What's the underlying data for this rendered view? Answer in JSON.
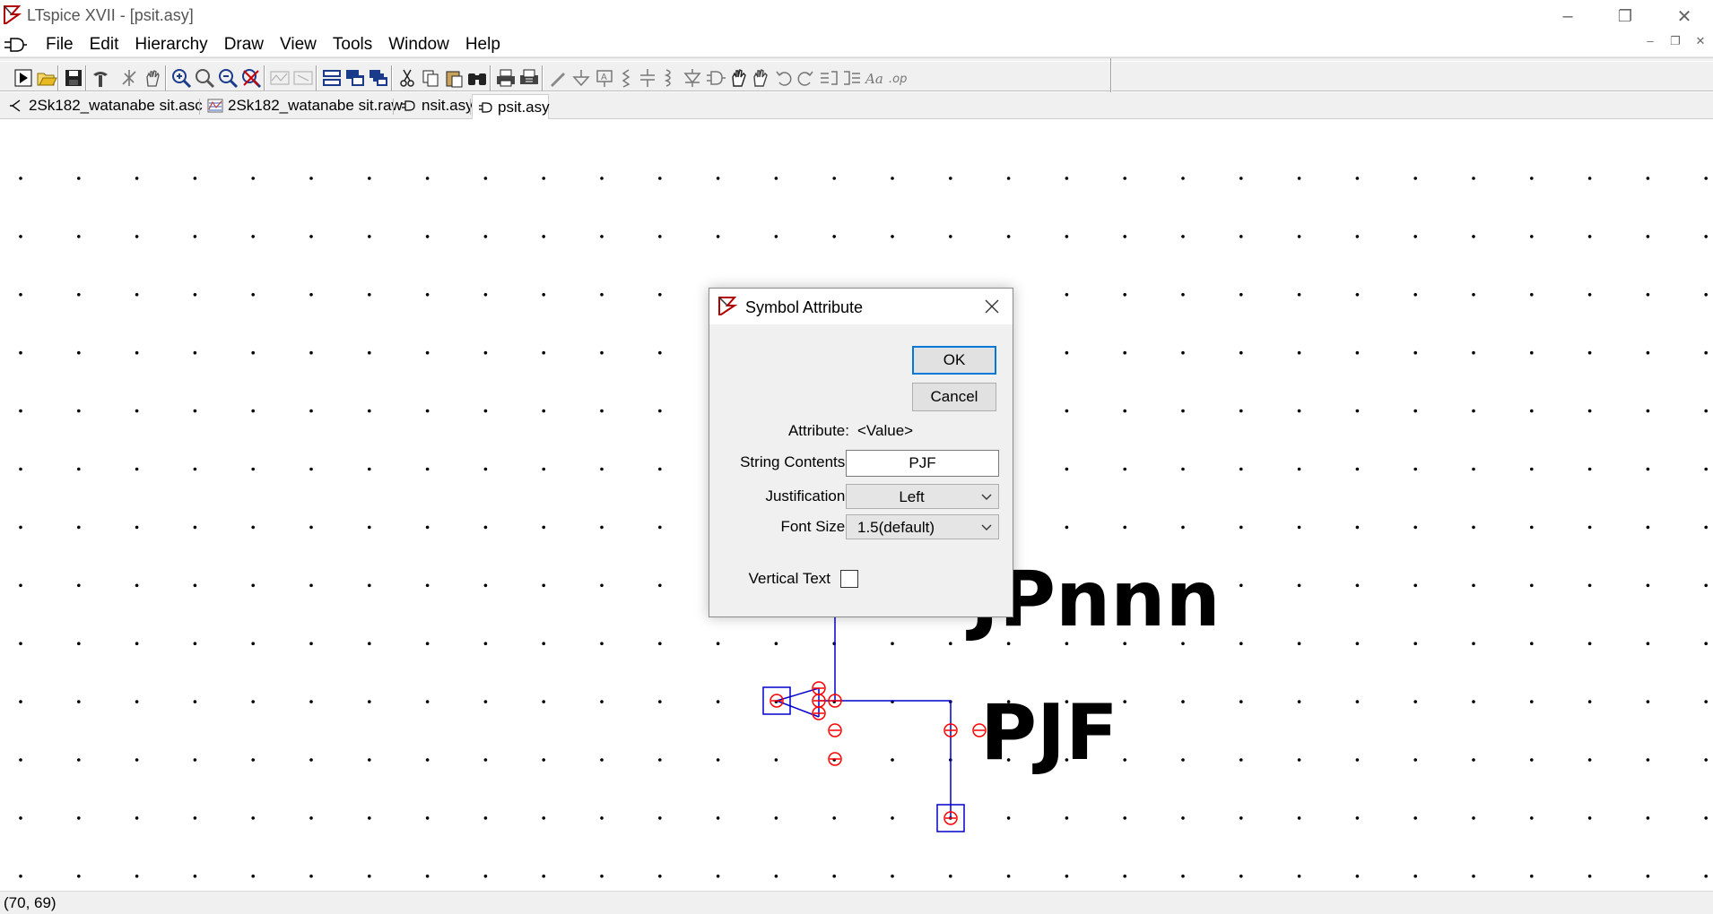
{
  "window": {
    "title": "LTspice XVII - [psit.asy]",
    "controls": {
      "minimize": "–",
      "restore": "❐",
      "close": "✕"
    }
  },
  "menu": {
    "items": [
      {
        "label": "File"
      },
      {
        "label": "Edit"
      },
      {
        "label": "Hierarchy"
      },
      {
        "label": "Draw"
      },
      {
        "label": "View"
      },
      {
        "label": "Tools"
      },
      {
        "label": "Window"
      },
      {
        "label": "Help"
      }
    ],
    "mdi_controls": [
      "–",
      "❐",
      "✕"
    ]
  },
  "toolbar": {
    "buttons": [
      "run-icon",
      "open-icon",
      "save-icon",
      "control-panel-icon",
      "halt-icon",
      "pan-icon",
      "zoom-in-icon",
      "zoom-out-icon",
      "zoom-fit-icon",
      "zoom-cancel-icon",
      "autorange-icon",
      "delete-trace-icon",
      "tile-horizontal-icon",
      "tile-vertical-icon",
      "cascade-icon",
      "cut-icon",
      "copy-icon",
      "paste-icon",
      "find-icon",
      "print-icon",
      "print-preview-icon",
      "draw-wire-icon",
      "ground-icon",
      "label-net-icon",
      "resistor-icon",
      "capacitor-icon",
      "inductor-icon",
      "diode-icon",
      "component-icon",
      "move-icon",
      "drag-icon",
      "undo-icon",
      "redo-icon",
      "rotate-icon",
      "mirror-icon",
      "text-icon",
      "spice-directive-icon"
    ]
  },
  "tabs": [
    {
      "label": "2Sk182_watanabe sit.asc",
      "icon": "schematic-icon",
      "active": false
    },
    {
      "label": "2Sk182_watanabe sit.raw",
      "icon": "waveform-icon",
      "active": false
    },
    {
      "label": "nsit.asy",
      "icon": "symbol-icon",
      "active": false
    },
    {
      "label": "psit.asy",
      "icon": "symbol-icon",
      "active": true
    }
  ],
  "canvas": {
    "value_text": "JPnnn",
    "prefix_text": "PJF",
    "colors": {
      "wire": "#0000cc",
      "pin_circle": "#ff0000",
      "grid_dot": "#000000"
    }
  },
  "dialog": {
    "title": "Symbol Attribute",
    "ok_label": "OK",
    "cancel_label": "Cancel",
    "attribute_label": "Attribute:",
    "attribute_value": "<Value>",
    "string_contents_label": "String Contents:",
    "string_contents_value": "PJF",
    "justification_label": "Justification:",
    "justification_value": "Left",
    "font_size_label": "Font Size:",
    "font_size_value": "1.5(default)",
    "vertical_text_label": "Vertical Text",
    "vertical_text_checked": false,
    "accent_color": "#0078d7"
  },
  "status": {
    "coords": "(70, 69)"
  }
}
